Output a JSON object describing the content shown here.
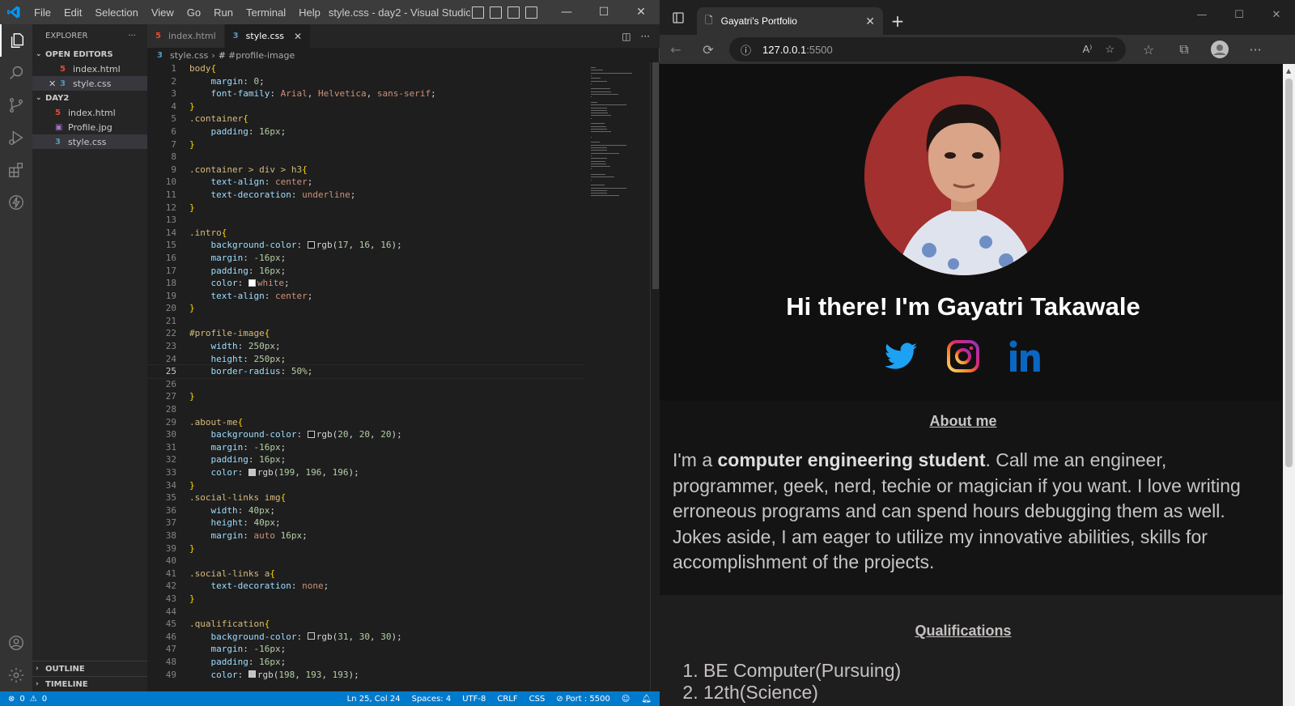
{
  "vscode": {
    "menu": [
      "File",
      "Edit",
      "Selection",
      "View",
      "Go",
      "Run",
      "Terminal",
      "Help"
    ],
    "window_title": "style.css - day2 - Visual Studio ...",
    "sidebar": {
      "title": "EXPLORER",
      "open_editors_label": "OPEN EDITORS",
      "open_editors": [
        "index.html",
        "style.css"
      ],
      "folder_label": "DAY2",
      "files": [
        "index.html",
        "Profile.jpg",
        "style.css"
      ],
      "outline_label": "OUTLINE",
      "timeline_label": "TIMELINE"
    },
    "tabs": [
      {
        "label": "index.html"
      },
      {
        "label": "style.css"
      }
    ],
    "breadcrumb": {
      "file": "style.css",
      "symbol": "#profile-image"
    },
    "current_line": 25,
    "statusbar": {
      "errors": "0",
      "warnings": "0",
      "position": "Ln 25, Col 24",
      "spaces": "Spaces: 4",
      "encoding": "UTF-8",
      "eol": "CRLF",
      "language": "CSS",
      "port": "Port : 5500"
    },
    "code_lines": [
      [
        [
          "sel",
          "body"
        ],
        [
          "brace",
          "{"
        ]
      ],
      [
        [
          "ind",
          "    "
        ],
        [
          "prop",
          "margin"
        ],
        [
          "p",
          ": "
        ],
        [
          "num",
          "0"
        ],
        [
          "p",
          ";"
        ]
      ],
      [
        [
          "ind",
          "    "
        ],
        [
          "prop",
          "font-family"
        ],
        [
          "p",
          ": "
        ],
        [
          "val",
          "Arial"
        ],
        [
          "p",
          ", "
        ],
        [
          "val",
          "Helvetica"
        ],
        [
          "p",
          ", "
        ],
        [
          "val",
          "sans-serif"
        ],
        [
          "p",
          ";"
        ]
      ],
      [
        [
          "brace",
          "}"
        ]
      ],
      [
        [
          "sel",
          ".container"
        ],
        [
          "brace",
          "{"
        ]
      ],
      [
        [
          "ind",
          "    "
        ],
        [
          "prop",
          "padding"
        ],
        [
          "p",
          ": "
        ],
        [
          "num",
          "16px"
        ],
        [
          "p",
          ";"
        ]
      ],
      [
        [
          "brace",
          "}"
        ]
      ],
      [],
      [
        [
          "sel",
          ".container > div > h3"
        ],
        [
          "brace",
          "{"
        ]
      ],
      [
        [
          "ind",
          "    "
        ],
        [
          "prop",
          "text-align"
        ],
        [
          "p",
          ": "
        ],
        [
          "val",
          "center"
        ],
        [
          "p",
          ";"
        ]
      ],
      [
        [
          "ind",
          "    "
        ],
        [
          "prop",
          "text-decoration"
        ],
        [
          "p",
          ": "
        ],
        [
          "val",
          "underline"
        ],
        [
          "p",
          ";"
        ]
      ],
      [
        [
          "brace",
          "}"
        ]
      ],
      [],
      [
        [
          "sel",
          ".intro"
        ],
        [
          "brace",
          "{"
        ]
      ],
      [
        [
          "ind",
          "    "
        ],
        [
          "prop",
          "background-color"
        ],
        [
          "p",
          ": "
        ],
        [
          "swatch",
          "#111010"
        ],
        [
          "p",
          "rgb("
        ],
        [
          "num",
          "17"
        ],
        [
          "p",
          ", "
        ],
        [
          "num",
          "16"
        ],
        [
          "p",
          ", "
        ],
        [
          "num",
          "16"
        ],
        [
          "p",
          ");"
        ]
      ],
      [
        [
          "ind",
          "    "
        ],
        [
          "prop",
          "margin"
        ],
        [
          "p",
          ": "
        ],
        [
          "num",
          "-16px"
        ],
        [
          "p",
          ";"
        ]
      ],
      [
        [
          "ind",
          "    "
        ],
        [
          "prop",
          "padding"
        ],
        [
          "p",
          ": "
        ],
        [
          "num",
          "16px"
        ],
        [
          "p",
          ";"
        ]
      ],
      [
        [
          "ind",
          "    "
        ],
        [
          "prop",
          "color"
        ],
        [
          "p",
          ": "
        ],
        [
          "swatch",
          "#ffffff"
        ],
        [
          "val",
          "white"
        ],
        [
          "p",
          ";"
        ]
      ],
      [
        [
          "ind",
          "    "
        ],
        [
          "prop",
          "text-align"
        ],
        [
          "p",
          ": "
        ],
        [
          "val",
          "center"
        ],
        [
          "p",
          ";"
        ]
      ],
      [
        [
          "brace",
          "}"
        ]
      ],
      [],
      [
        [
          "sel",
          "#profile-image"
        ],
        [
          "brace",
          "{"
        ]
      ],
      [
        [
          "ind",
          "    "
        ],
        [
          "prop",
          "width"
        ],
        [
          "p",
          ": "
        ],
        [
          "num",
          "250px"
        ],
        [
          "p",
          ";"
        ]
      ],
      [
        [
          "ind",
          "    "
        ],
        [
          "prop",
          "height"
        ],
        [
          "p",
          ": "
        ],
        [
          "num",
          "250px"
        ],
        [
          "p",
          ";"
        ]
      ],
      [
        [
          "ind",
          "    "
        ],
        [
          "prop",
          "border-radius"
        ],
        [
          "p",
          ": "
        ],
        [
          "num",
          "50%"
        ],
        [
          "p",
          ";"
        ]
      ],
      [],
      [
        [
          "brace",
          "}"
        ]
      ],
      [],
      [
        [
          "sel",
          ".about-me"
        ],
        [
          "brace",
          "{"
        ]
      ],
      [
        [
          "ind",
          "    "
        ],
        [
          "prop",
          "background-color"
        ],
        [
          "p",
          ": "
        ],
        [
          "swatch",
          "#141414"
        ],
        [
          "p",
          "rgb("
        ],
        [
          "num",
          "20"
        ],
        [
          "p",
          ", "
        ],
        [
          "num",
          "20"
        ],
        [
          "p",
          ", "
        ],
        [
          "num",
          "20"
        ],
        [
          "p",
          ");"
        ]
      ],
      [
        [
          "ind",
          "    "
        ],
        [
          "prop",
          "margin"
        ],
        [
          "p",
          ": "
        ],
        [
          "num",
          "-16px"
        ],
        [
          "p",
          ";"
        ]
      ],
      [
        [
          "ind",
          "    "
        ],
        [
          "prop",
          "padding"
        ],
        [
          "p",
          ": "
        ],
        [
          "num",
          "16px"
        ],
        [
          "p",
          ";"
        ]
      ],
      [
        [
          "ind",
          "    "
        ],
        [
          "prop",
          "color"
        ],
        [
          "p",
          ": "
        ],
        [
          "swatch",
          "#c7c4c4"
        ],
        [
          "p",
          "rgb("
        ],
        [
          "num",
          "199"
        ],
        [
          "p",
          ", "
        ],
        [
          "num",
          "196"
        ],
        [
          "p",
          ", "
        ],
        [
          "num",
          "196"
        ],
        [
          "p",
          ");"
        ]
      ],
      [
        [
          "brace",
          "}"
        ]
      ],
      [
        [
          "sel",
          ".social-links img"
        ],
        [
          "brace",
          "{"
        ]
      ],
      [
        [
          "ind",
          "    "
        ],
        [
          "prop",
          "width"
        ],
        [
          "p",
          ": "
        ],
        [
          "num",
          "40px"
        ],
        [
          "p",
          ";"
        ]
      ],
      [
        [
          "ind",
          "    "
        ],
        [
          "prop",
          "height"
        ],
        [
          "p",
          ": "
        ],
        [
          "num",
          "40px"
        ],
        [
          "p",
          ";"
        ]
      ],
      [
        [
          "ind",
          "    "
        ],
        [
          "prop",
          "margin"
        ],
        [
          "p",
          ": "
        ],
        [
          "val",
          "auto"
        ],
        [
          "p",
          " "
        ],
        [
          "num",
          "16px"
        ],
        [
          "p",
          ";"
        ]
      ],
      [
        [
          "brace",
          "}"
        ]
      ],
      [],
      [
        [
          "sel",
          ".social-links a"
        ],
        [
          "brace",
          "{"
        ]
      ],
      [
        [
          "ind",
          "    "
        ],
        [
          "prop",
          "text-decoration"
        ],
        [
          "p",
          ": "
        ],
        [
          "val",
          "none"
        ],
        [
          "p",
          ";"
        ]
      ],
      [
        [
          "brace",
          "}"
        ]
      ],
      [],
      [
        [
          "sel",
          ".qualification"
        ],
        [
          "brace",
          "{"
        ]
      ],
      [
        [
          "ind",
          "    "
        ],
        [
          "prop",
          "background-color"
        ],
        [
          "p",
          ": "
        ],
        [
          "swatch",
          "#1f1e1e"
        ],
        [
          "p",
          "rgb("
        ],
        [
          "num",
          "31"
        ],
        [
          "p",
          ", "
        ],
        [
          "num",
          "30"
        ],
        [
          "p",
          ", "
        ],
        [
          "num",
          "30"
        ],
        [
          "p",
          ");"
        ]
      ],
      [
        [
          "ind",
          "    "
        ],
        [
          "prop",
          "margin"
        ],
        [
          "p",
          ": "
        ],
        [
          "num",
          "-16px"
        ],
        [
          "p",
          ";"
        ]
      ],
      [
        [
          "ind",
          "    "
        ],
        [
          "prop",
          "padding"
        ],
        [
          "p",
          ": "
        ],
        [
          "num",
          "16px"
        ],
        [
          "p",
          ";"
        ]
      ],
      [
        [
          "ind",
          "    "
        ],
        [
          "prop",
          "color"
        ],
        [
          "p",
          ": "
        ],
        [
          "swatch",
          "#c6c1c1"
        ],
        [
          "p",
          "rgb("
        ],
        [
          "num",
          "198"
        ],
        [
          "p",
          ", "
        ],
        [
          "num",
          "193"
        ],
        [
          "p",
          ", "
        ],
        [
          "num",
          "193"
        ],
        [
          "p",
          ");"
        ]
      ]
    ]
  },
  "browser": {
    "tab_title": "Gayatri's Portfolio",
    "address_host": "127.0.0.1",
    "address_port": ":5500",
    "page": {
      "heading": "Hi there! I'm Gayatri Takawale",
      "social_links": [
        "twitter-icon",
        "instagram-icon",
        "linkedin-icon"
      ],
      "about_title": "About me",
      "about_prefix": "I'm a ",
      "about_bold": "computer engineering student",
      "about_rest": ". Call me an engineer, programmer, geek, nerd, techie or magician if you want. I love writing erroneous programs and can spend hours debugging them as well. Jokes aside, I am eager to utilize my innovative abilities, skills for accomplishment of the projects.",
      "qualifications_title": "Qualifications",
      "qualifications": [
        "BE Computer(Pursuing)",
        "12th(Science)"
      ]
    }
  },
  "colors": {
    "vscode_accent": "#007acc",
    "intro_bg": "#111010",
    "about_bg": "#141414",
    "qualification_bg": "#1f1e1e"
  }
}
